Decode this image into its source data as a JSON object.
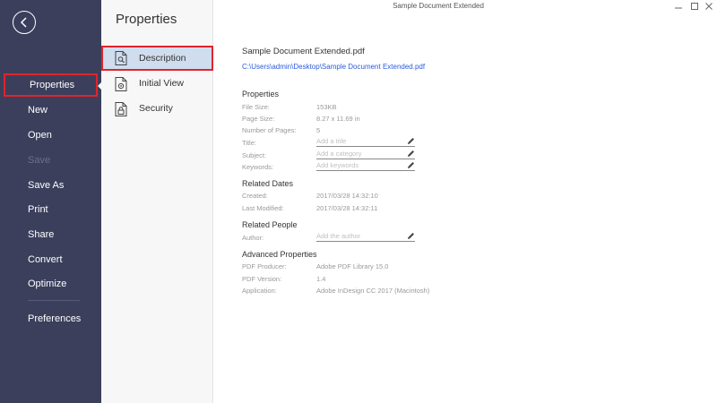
{
  "window": {
    "title": "Sample Document Extended",
    "controls": [
      "minimize-icon",
      "restore-icon",
      "close-icon"
    ]
  },
  "leftnav": {
    "items": [
      {
        "label": "Properties",
        "state": "active"
      },
      {
        "label": "New",
        "state": "normal"
      },
      {
        "label": "Open",
        "state": "normal"
      },
      {
        "label": "Save",
        "state": "disabled"
      },
      {
        "label": "Save As",
        "state": "normal"
      },
      {
        "label": "Print",
        "state": "normal"
      },
      {
        "label": "Share",
        "state": "normal"
      },
      {
        "label": "Convert",
        "state": "normal"
      },
      {
        "label": "Optimize",
        "state": "normal"
      },
      {
        "label": "Preferences",
        "state": "normal"
      }
    ],
    "back_icon": "back-arrow-circle-icon"
  },
  "midpanel": {
    "title": "Properties",
    "items": [
      {
        "label": "Description",
        "icon": "document-search-icon",
        "state": "active"
      },
      {
        "label": "Initial View",
        "icon": "document-view-icon",
        "state": "normal"
      },
      {
        "label": "Security",
        "icon": "document-lock-icon",
        "state": "normal"
      }
    ]
  },
  "document": {
    "name": "Sample Document Extended.pdf",
    "path": "C:\\Users\\admin\\Desktop\\Sample Document Extended.pdf"
  },
  "properties": {
    "heading": "Properties",
    "file_size_label": "File Size:",
    "file_size": "153KB",
    "page_size_label": "Page Size:",
    "page_size": "8.27 x 11.69 in",
    "pages_label": "Number of Pages:",
    "pages": "5",
    "title_label": "Title:",
    "title_placeholder": "Add a title",
    "subject_label": "Subject:",
    "subject_placeholder": "Add a category",
    "keywords_label": "Keywords:",
    "keywords_placeholder": "Add keywords"
  },
  "dates": {
    "heading": "Related Dates",
    "created_label": "Created:",
    "created": "2017/03/28 14:32:10",
    "modified_label": "Last Modified:",
    "modified": "2017/03/28 14:32:11"
  },
  "people": {
    "heading": "Related People",
    "author_label": "Author:",
    "author_placeholder": "Add the author"
  },
  "advanced": {
    "heading": "Advanced Properties",
    "producer_label": "PDF Producer:",
    "producer": "Adobe PDF Library 15.0",
    "version_label": "PDF Version:",
    "version": "1.4",
    "application_label": "Application:",
    "application": "Adobe InDesign CC 2017 (Macintosh)"
  },
  "colors": {
    "nav_bg": "#3b3f5c",
    "highlight_border": "#e0242a",
    "active_item_bg": "#cfddee",
    "link": "#2b5cd9"
  }
}
